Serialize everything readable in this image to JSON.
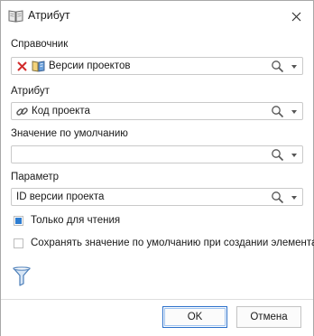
{
  "window": {
    "title": "Атрибут",
    "title_icon": "book-icon",
    "close_icon": "close-icon"
  },
  "fields": {
    "dictionary": {
      "label": "Справочник",
      "value": "Версии проектов",
      "icons": [
        "red-x-icon",
        "book-icon"
      ]
    },
    "attribute": {
      "label": "Атрибут",
      "value": "Код проекта",
      "icons": [
        "link-icon"
      ]
    },
    "default_value": {
      "label": "Значение по умолчанию",
      "value": ""
    },
    "parameter": {
      "label": "Параметр",
      "value": "ID версии проекта"
    }
  },
  "checkboxes": {
    "read_only": {
      "label": "Только для чтения",
      "checked": true
    },
    "save_default": {
      "label": "Сохранять значение по умолчанию при создании элемента",
      "checked": false
    }
  },
  "filter_icon": "funnel-icon",
  "buttons": {
    "ok": "OK",
    "cancel": "Отмена"
  },
  "colors": {
    "accent": "#2e7dd1",
    "primary_border": "#2a6fc9",
    "red_x": "#d22b2b"
  }
}
